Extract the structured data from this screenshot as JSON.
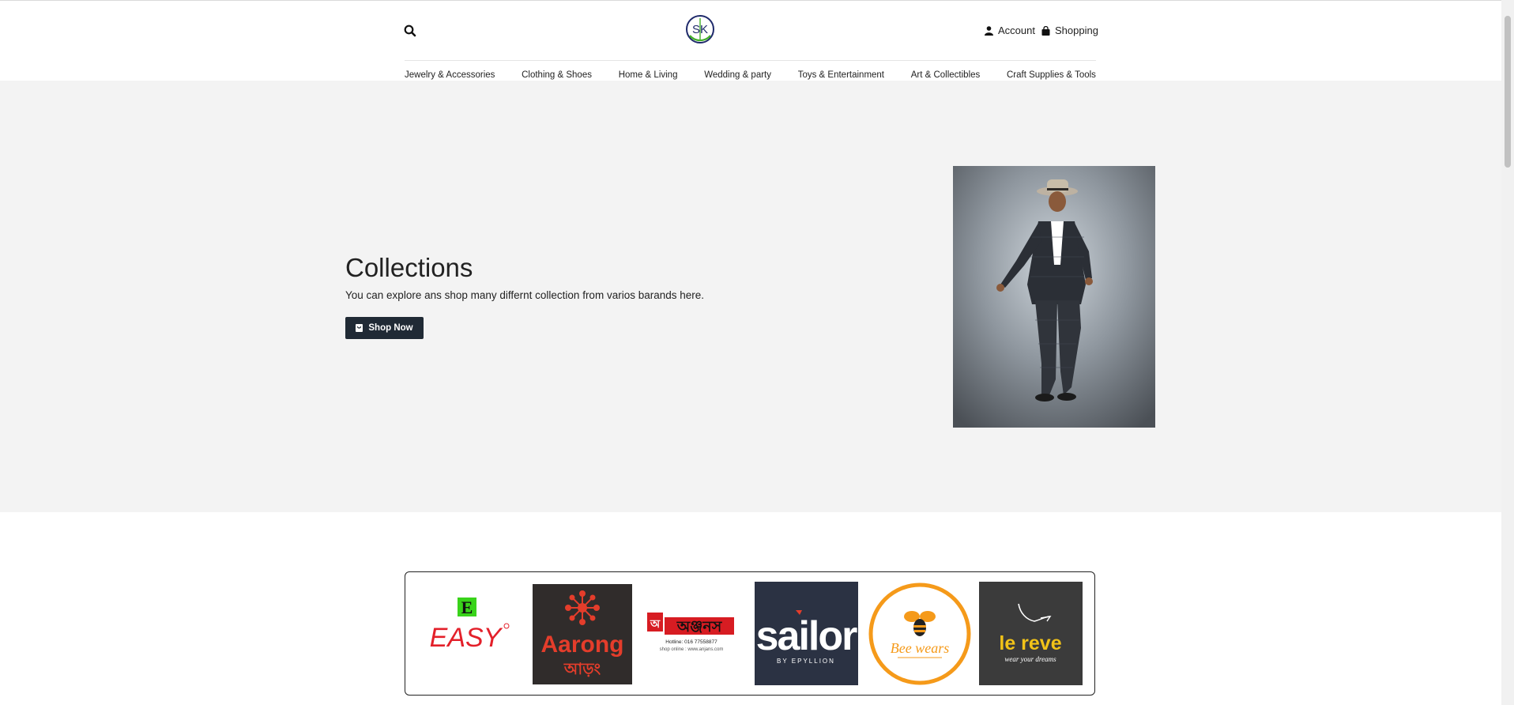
{
  "header": {
    "logo_text": "SK",
    "account_label": "Account",
    "shopping_label": "Shopping",
    "icons": [
      "search-icon",
      "user-icon",
      "shopping-bag-icon"
    ]
  },
  "nav": {
    "items": [
      {
        "label": "Jewelry & Accessories"
      },
      {
        "label": "Clothing & Shoes"
      },
      {
        "label": "Home & Living"
      },
      {
        "label": "Wedding & party"
      },
      {
        "label": "Toys & Entertainment"
      },
      {
        "label": "Art & Collectibles"
      },
      {
        "label": "Craft Supplies & Tools"
      }
    ]
  },
  "hero": {
    "title": "Collections",
    "subtitle": "You can explore ans shop many differnt collection from varios barands here.",
    "button_label": "Shop Now",
    "button_icon": "bag-icon"
  },
  "brands": {
    "logos": [
      {
        "name": "easy",
        "text": "EASY",
        "mark": "E"
      },
      {
        "name": "aarong",
        "text": "Aarong",
        "text_bn": "আড়ং"
      },
      {
        "name": "anjans",
        "text_bn": "অঞ্জনস",
        "hotline": "Hotline: 016 77558877",
        "site": "shop online : www.anjans.com"
      },
      {
        "name": "sailor",
        "text": "sailor",
        "sub": "BY EPYLLION"
      },
      {
        "name": "bee-wears",
        "text": "Bee wears"
      },
      {
        "name": "le-reve",
        "text": "le reve",
        "sub": "wear your dreams"
      }
    ]
  },
  "colors": {
    "hero_bg": "#f3f3f3",
    "button_bg": "#202a35",
    "aarong_red": "#e43d2b",
    "easy_red": "#e3202a",
    "easy_green": "#39d31a",
    "sailor_navy": "#2b3243",
    "bee_orange": "#f59a1a",
    "lereve_bg": "#3b3b3b",
    "lereve_yellow": "#f2c318"
  }
}
